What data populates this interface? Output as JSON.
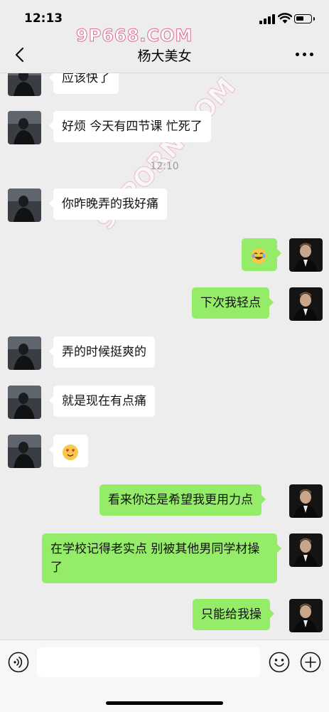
{
  "status_bar": {
    "time": "12:13"
  },
  "watermarks": {
    "top": "9P668.COM",
    "diagonal": "91PORN.COM"
  },
  "header": {
    "title": "杨大美女"
  },
  "chat": {
    "timestamp": "12:10",
    "messages": [
      {
        "side": "in",
        "text": "应该快了"
      },
      {
        "side": "in",
        "text": "好烦 今天有四节课 忙死了"
      },
      {
        "side": "in",
        "text": "你昨晚弄的我好痛"
      },
      {
        "side": "out",
        "emoji": "laughing-tears-emoji"
      },
      {
        "side": "out",
        "text": "下次我轻点"
      },
      {
        "side": "in",
        "text": "弄的时候挺爽的"
      },
      {
        "side": "in",
        "text": "就是现在有点痛"
      },
      {
        "side": "in",
        "emoji": "heart-eyes-emoji"
      },
      {
        "side": "out",
        "text": "看来你还是希望我更用力点"
      },
      {
        "side": "out",
        "text": "在学校记得老实点 别被其他男同学材操了"
      },
      {
        "side": "out",
        "text": "只能给我操"
      }
    ]
  },
  "input_bar": {
    "value": "",
    "placeholder": ""
  },
  "colors": {
    "background": "#ededed",
    "outgoing_bubble": "#95ec69",
    "incoming_bubble": "#ffffff"
  }
}
